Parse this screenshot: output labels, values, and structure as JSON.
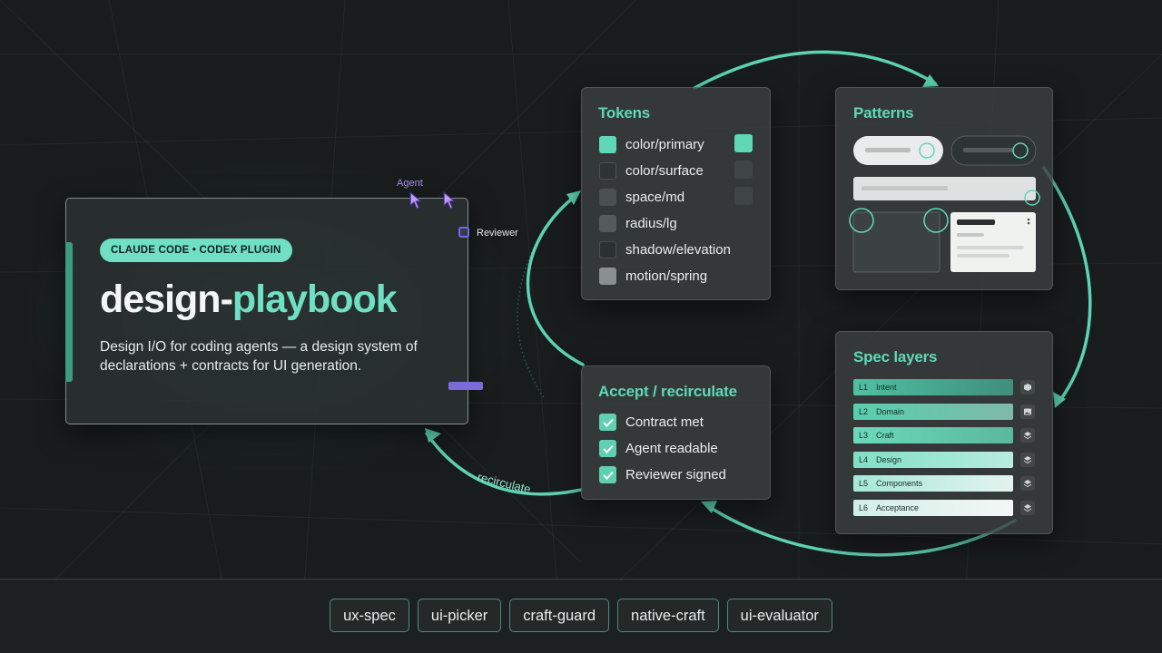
{
  "hero": {
    "badge": "CLAUDE CODE • CODEX PLUGIN",
    "title_main": "design-",
    "title_accent": "playbook",
    "description": "Design I/O for coding agents — a design system of declarations + contracts for UI generation."
  },
  "annotations": {
    "agent": "Agent",
    "reviewer": "Reviewer",
    "recirculate": "recirculate"
  },
  "tokens": {
    "title": "Tokens",
    "items": [
      {
        "label": "color/primary",
        "icon": "teal-swatch"
      },
      {
        "label": "color/surface",
        "icon": "dark-swatch"
      },
      {
        "label": "space/md",
        "icon": "gray-swatch"
      },
      {
        "label": "radius/lg",
        "icon": "gray-swatch"
      },
      {
        "label": "shadow/elevation",
        "icon": "dark-swatch"
      },
      {
        "label": "motion/spring",
        "icon": "light-gray-swatch"
      }
    ]
  },
  "patterns": {
    "title": "Patterns"
  },
  "accept": {
    "title": "Accept / recirculate",
    "items": [
      "Contract met",
      "Agent readable",
      "Reviewer signed"
    ]
  },
  "spec_layers": {
    "title": "Spec layers",
    "layers": [
      {
        "code": "L1",
        "name": "Intent",
        "icon": "cube-icon"
      },
      {
        "code": "L2",
        "name": "Domain",
        "icon": "image-icon"
      },
      {
        "code": "L3",
        "name": "Craft",
        "icon": "layers-icon"
      },
      {
        "code": "L4",
        "name": "Design",
        "icon": "layers-icon"
      },
      {
        "code": "L5",
        "name": "Components",
        "icon": "layers-icon"
      },
      {
        "code": "L6",
        "name": "Acceptance",
        "icon": "layers-icon"
      }
    ]
  },
  "footer": {
    "chips": [
      "ux-spec",
      "ui-picker",
      "craft-guard",
      "native-craft",
      "ui-evaluator"
    ]
  },
  "colors": {
    "accent": "#6fe0c4",
    "background": "#191c1d",
    "agent_violet": "#a88cf2"
  }
}
